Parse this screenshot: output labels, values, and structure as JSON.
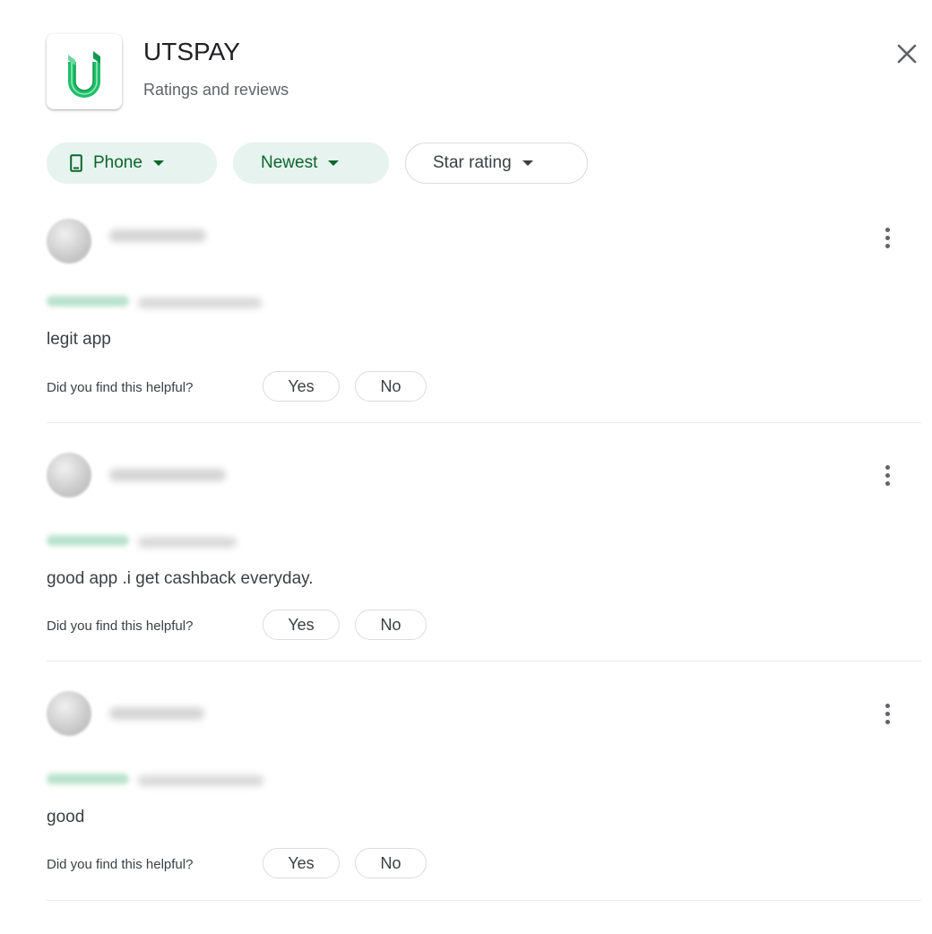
{
  "app": {
    "name": "UTSPAY",
    "subtitle": "Ratings and reviews",
    "brand_color": "#1fbf6a"
  },
  "close": {
    "icon": "close-icon"
  },
  "filters": [
    {
      "label": "Phone",
      "icon": "phone-icon",
      "active": true
    },
    {
      "label": "Newest",
      "active": true
    },
    {
      "label": "Star rating",
      "active": false
    }
  ],
  "reviews": [
    {
      "text": "legit app",
      "helpful_prompt": "Did you find this helpful?",
      "yes": "Yes",
      "no": "No"
    },
    {
      "text": "good app .i get cashback everyday.",
      "helpful_prompt": "Did you find this helpful?",
      "yes": "Yes",
      "no": "No"
    },
    {
      "text": "good",
      "helpful_prompt": "Did you find this helpful?",
      "yes": "Yes",
      "no": "No"
    }
  ],
  "colors": {
    "chip_active_bg": "#e6f3ef",
    "chip_active_text": "#0d652d",
    "divider": "#e8eaed"
  }
}
